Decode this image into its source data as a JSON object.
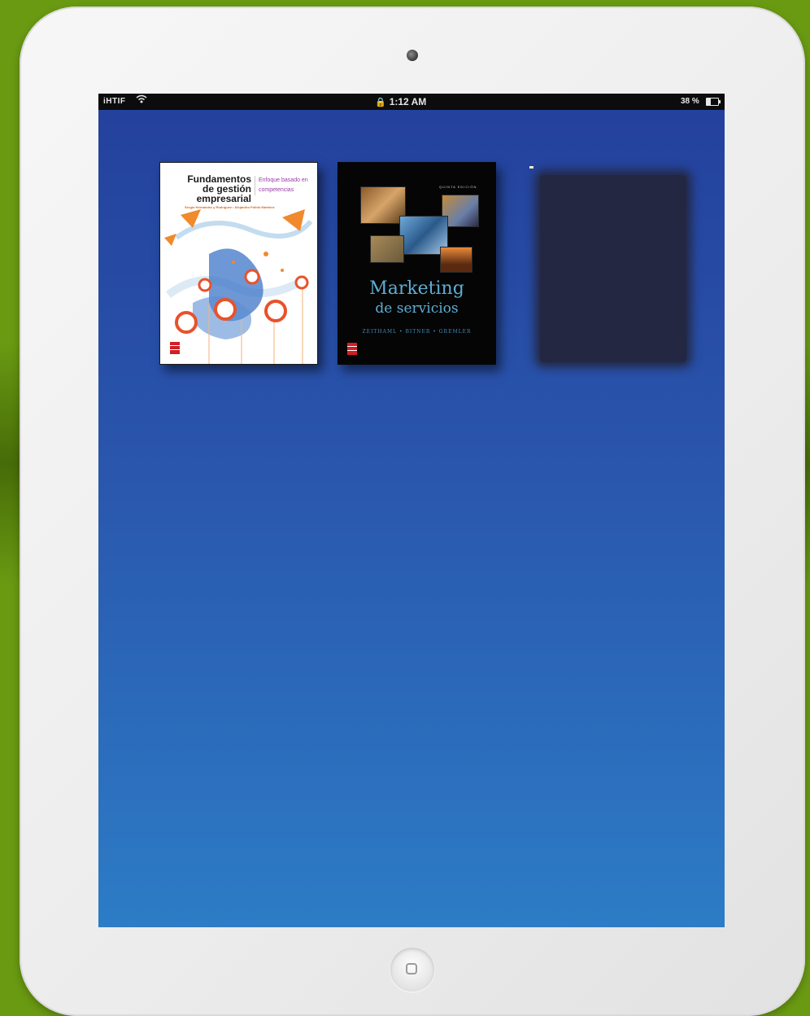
{
  "status_bar": {
    "carrier": "iHTIF",
    "time": "1:12 AM",
    "battery": "38 %",
    "wifi_icon": "wifi-icon",
    "lock_icon": "lock-icon",
    "battery_icon": "battery-icon"
  },
  "books": [
    {
      "title": "Fundamentos de gestión empresarial",
      "subtitle": "Enfoque basado en competencias",
      "authors": "Sergio Hernández y Rodríguez • Alejandro Pulido Martínez",
      "publisher_logo": "mcgraw-hill-logo"
    },
    {
      "edition": "QUINTA EDICIÓN",
      "title": "Marketing",
      "subtitle": "de servicios",
      "authors": "ZEITHAML • BITNER • GREMLER",
      "publisher_logo": "mcgraw-hill-logo"
    }
  ],
  "colors": {
    "background": "#6a9a12",
    "screen_top": "#23409c",
    "screen_bottom": "#2c7cc6",
    "book2_title": "#5eaed3"
  }
}
